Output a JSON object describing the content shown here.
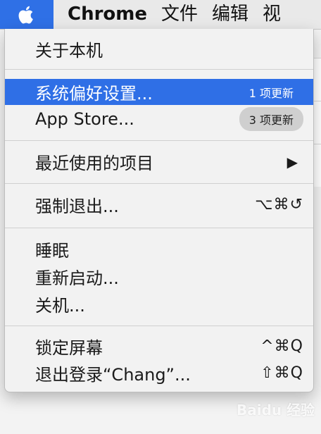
{
  "menubar": {
    "app_name": "Chrome",
    "items": [
      "文件",
      "编辑",
      "视"
    ]
  },
  "apple_menu": {
    "about": "关于本机",
    "system_prefs": {
      "label": "系统偏好设置...",
      "badge": "1 项更新"
    },
    "app_store": {
      "label": "App Store...",
      "badge": "3 项更新"
    },
    "recent_items": {
      "label": "最近使用的项目",
      "arrow": "▶"
    },
    "force_quit": {
      "label": "强制退出...",
      "shortcut": "⌥⌘↺"
    },
    "sleep": "睡眠",
    "restart": "重新启动...",
    "shutdown": "关机...",
    "lock_screen": {
      "label": "锁定屏幕",
      "shortcut": "^⌘Q"
    },
    "logout": {
      "label": "退出登录“Chang”...",
      "shortcut": "⇧⌘Q"
    }
  },
  "watermark": "Baidu 经验",
  "colors": {
    "accent": "#2f6fe6",
    "menu_bg": "#f2f2f2",
    "menubar_bg": "#e9e9e9"
  }
}
